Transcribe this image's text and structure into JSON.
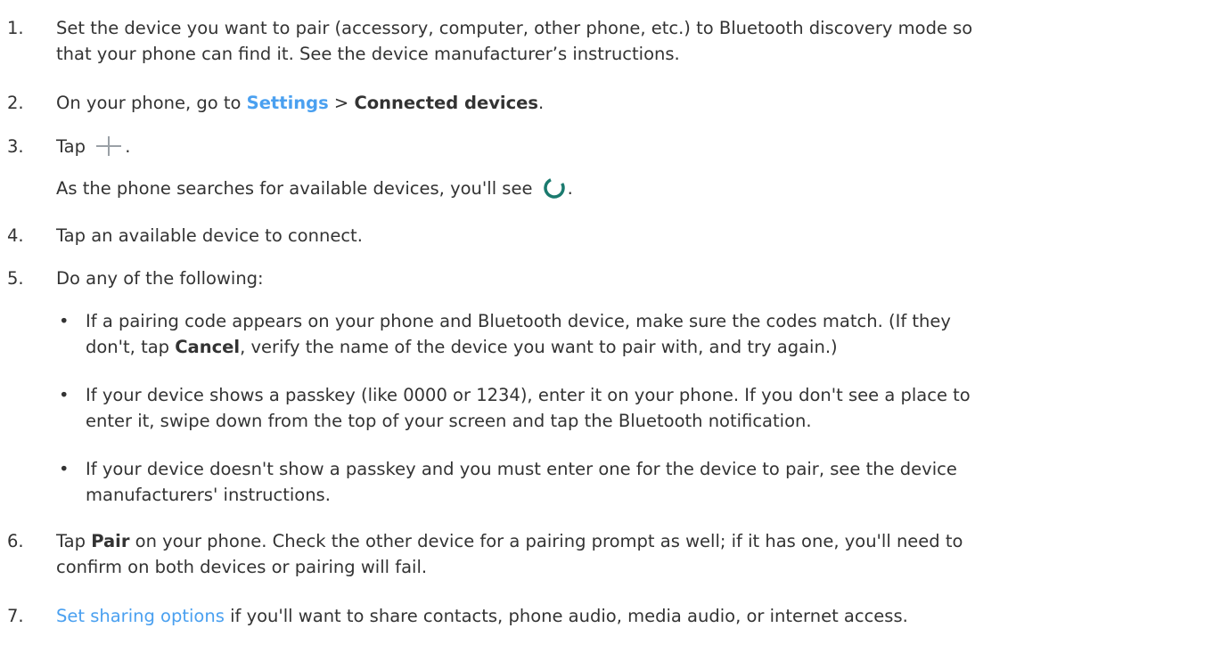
{
  "steps": [
    {
      "number": "1.",
      "lines": [
        "Set the device you want to pair (accessory, computer, other phone, etc.) to Bluetooth discovery mode so",
        "that your phone can find it. See the device manufacturer’s instructions."
      ]
    },
    {
      "number": "2.",
      "prefix": "On your phone, go to ",
      "link": "Settings",
      "middle": " > ",
      "bold": "Connected devices",
      "suffix": "."
    },
    {
      "number": "3.",
      "prefix": "Tap ",
      "icon": "plus-icon",
      "suffix": ".",
      "sub_prefix": "As the phone searches for available devices, you'll see ",
      "sub_icon": "spinner-icon",
      "sub_suffix": "."
    },
    {
      "number": "4.",
      "text": "Tap an available device to connect."
    },
    {
      "number": "5.",
      "text": "Do any of the following:",
      "bullets": [
        {
          "symbol": "•",
          "line1": "If a pairing code appears on your phone and Bluetooth device, make sure the codes match. (If they",
          "line2_prefix": "don't, tap ",
          "line2_bold": "Cancel",
          "line2_suffix": ", verify the name of the device you want to pair with, and try again.)"
        },
        {
          "symbol": "•",
          "line1": "If your device shows a passkey (like 0000 or 1234), enter it on your phone. If you don't see a place to",
          "line2": "enter it, swipe down from the top of your screen and tap the Bluetooth notification."
        },
        {
          "symbol": "•",
          "line1": "If your device doesn't show a passkey and you must enter one for the device to pair, see the device",
          "line2": "manufacturers' instructions."
        }
      ]
    },
    {
      "number": "6.",
      "prefix": "Tap ",
      "bold": "Pair",
      "suffix": " on your phone. Check the other device for a pairing prompt as well; if it has one, you'll need to",
      "line2": "confirm on both devices or pairing will fail."
    },
    {
      "number": "7.",
      "link": "Set sharing options",
      "suffix": " if you'll want to share contacts, phone audio, media audio, or internet access."
    }
  ],
  "colors": {
    "text": "#333333",
    "link": "#4aa0f0",
    "spinner": "#1a7a6e",
    "plus": "#9aa0a6"
  }
}
